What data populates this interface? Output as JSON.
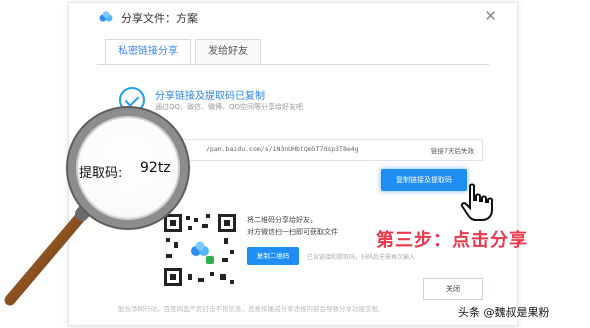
{
  "window": {
    "title": "分享文件：方案",
    "close_label": "✕"
  },
  "tabs": [
    {
      "label": "私密链接分享",
      "active": true
    },
    {
      "label": "发给好友",
      "active": false
    }
  ],
  "success": {
    "title": "分享链接及提取码已复制",
    "subtitle": "通过QQ、微信、微博、QQ空间等分享给好友吧"
  },
  "link": {
    "url": "/pan.baidu.com/s/1N3nUHbtQm5T7dsp3T8e4g",
    "expiry": "链接7天后失效"
  },
  "buttons": {
    "copy_link": "复制链接及提取码",
    "copy_qr": "复制二维码",
    "close": "关闭"
  },
  "qr": {
    "desc_line1": "将二维码分享给好友，",
    "desc_line2": "对方微信扫一扫即可获取文件",
    "note": "已含链接和提取码，扫码后无需再次输入"
  },
  "footer_notice": "配合净网行动，百度网盘严厉打击不良信息，恶意传播或分享违规内容会导致分享功能受限。",
  "magnifier": {
    "label": "提取码:",
    "value": "92tz"
  },
  "annotation": "第三步：点击分享",
  "watermark": "头条 @魏叔是果粉",
  "colors": {
    "accent": "#1e8ef5",
    "annotation": "#e8394d"
  }
}
